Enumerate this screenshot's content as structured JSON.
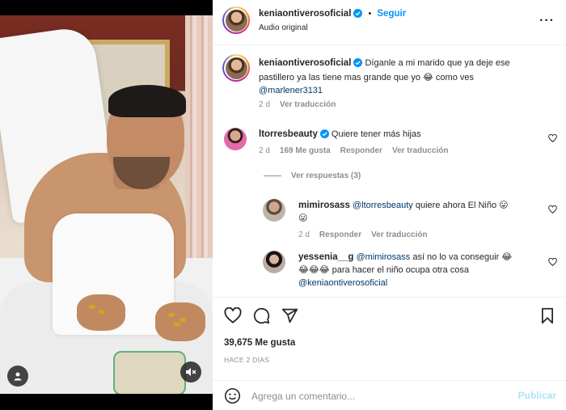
{
  "post": {
    "author": "keniaontiverosoficial",
    "audio": "Audio original",
    "follow_label": "Seguir",
    "separator": "•"
  },
  "icons": {
    "verified": "verified-badge-icon",
    "more": "more-options-icon",
    "heart": "heart-icon",
    "comment": "comment-icon",
    "share": "share-icon",
    "save": "bookmark-icon",
    "emoji": "emoji-icon",
    "user": "user-tag-icon",
    "mute": "muted-speaker-icon"
  },
  "colors": {
    "accent": "#0095f6",
    "mention": "#00376b",
    "muted": "#8e8e8e",
    "verified": "#0095f6",
    "publish_disabled": "#b2dffc"
  },
  "caption": {
    "user": "keniaontiverosoficial",
    "text": "Díganle a mi marido que ya deje ese pastillero ya las tiene mas grande que yo 😂 como ves",
    "mention": "@marlener3131",
    "time": "2 d",
    "translate": "Ver traducción"
  },
  "comments": [
    {
      "user": "ltorresbeauty",
      "text": "Quiere tener más hijas",
      "time": "2 d",
      "likes": "169 Me gusta",
      "reply": "Responder",
      "translate": "Ver traducción",
      "view_replies": "Ver respuestas (3)"
    }
  ],
  "replies": [
    {
      "user": "mimirosass",
      "mention": "@ltorresbeauty",
      "text": "quiere ahora El Niño 😛",
      "text2": "😛",
      "time": "2 d",
      "reply": "Responder",
      "translate": "Ver traducción"
    },
    {
      "user": "yessenia__g",
      "mention": "@mimirosass",
      "text": "así no lo va conseguir 😂",
      "text2": "😂😂😂 para hacer el niño ocupa otra cosa",
      "mention2": "@keniaontiverosoficial"
    }
  ],
  "stats": {
    "likes": "39,675 Me gusta",
    "date": "HACE 2 DÍAS"
  },
  "composer": {
    "placeholder": "Agrega un comentario...",
    "publish": "Publicar"
  }
}
